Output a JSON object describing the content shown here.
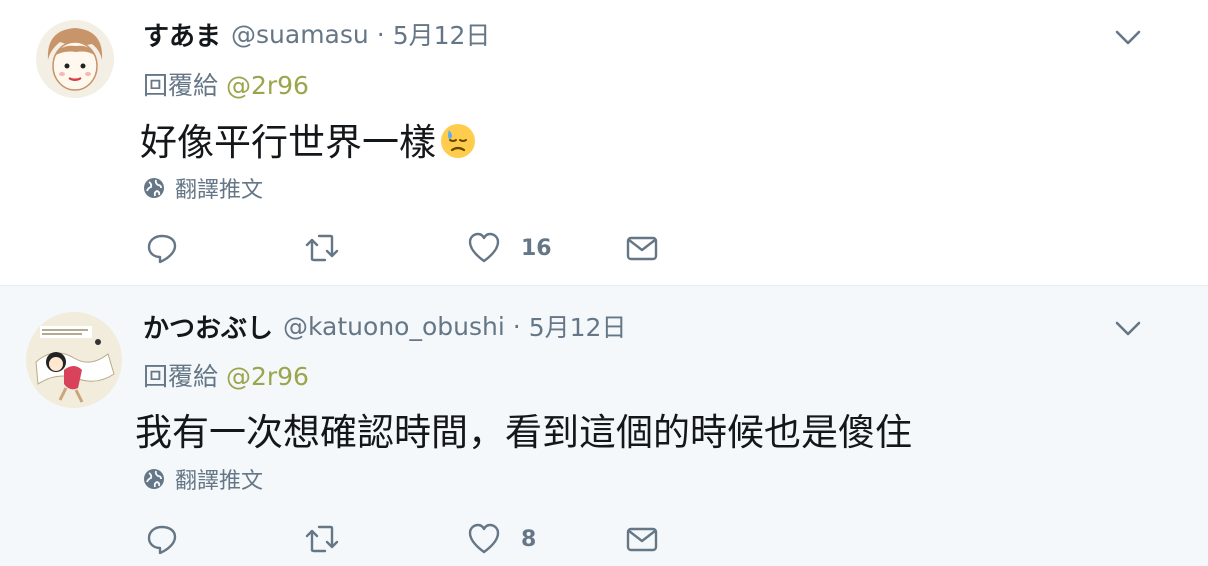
{
  "tweets": [
    {
      "name": "すあま",
      "handle": "@suamasu",
      "separator": "·",
      "date": "5月12日",
      "replying_prefix": "回覆給",
      "replying_to": "@2r96",
      "text": "好像平行世界一樣",
      "emoji": "downcast-face-with-sweat",
      "translate_label": "翻譯推文",
      "reply_count": "",
      "retweet_count": "",
      "like_count": "16"
    },
    {
      "name": "かつおぶし",
      "handle": "@katuono_obushi",
      "separator": "·",
      "date": "5月12日",
      "replying_prefix": "回覆給",
      "replying_to": "@2r96",
      "text": "我有一次想確認時間，看到這個的時候也是傻住",
      "translate_label": "翻譯推文",
      "reply_count": "",
      "retweet_count": "",
      "like_count": "8"
    }
  ],
  "colors": {
    "secondary_text": "#657786",
    "mention": "#9ba54c",
    "primary_text": "#14171a",
    "second_bg": "#f5f8fa"
  }
}
